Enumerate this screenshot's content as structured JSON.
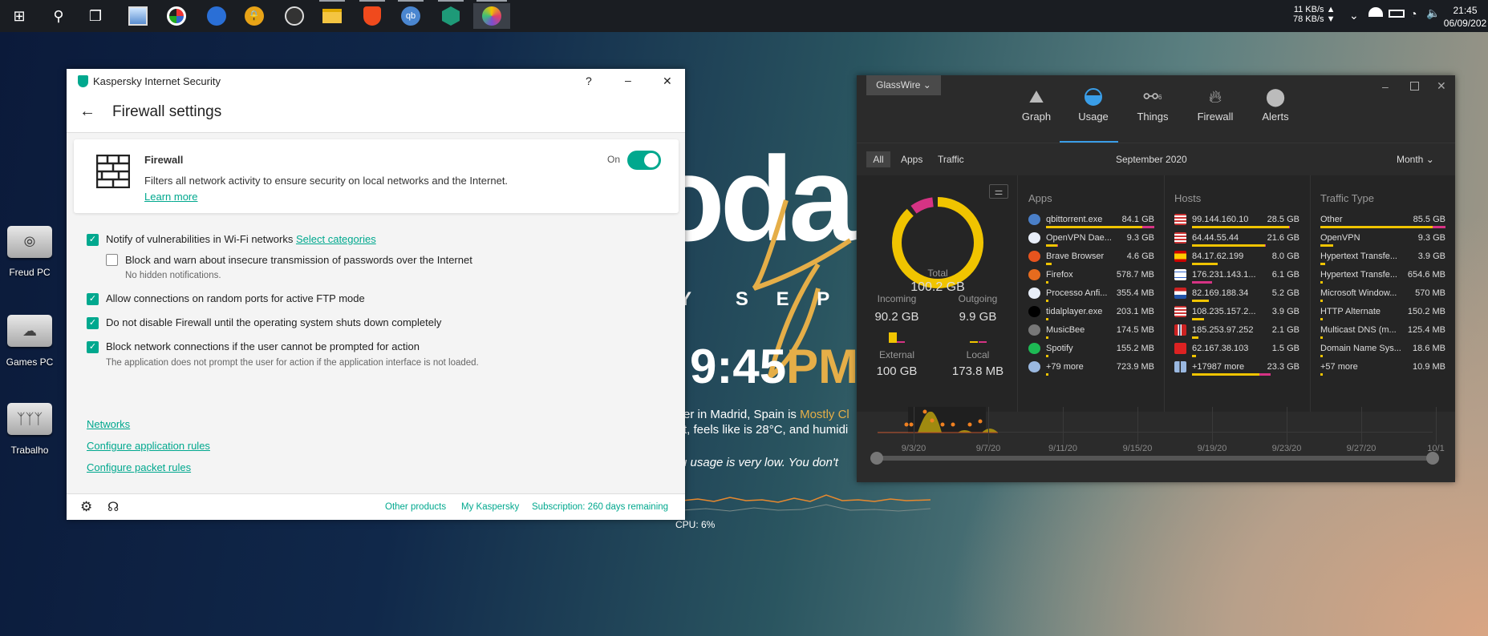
{
  "taskbar": {
    "apps": [
      "start",
      "search",
      "task-view",
      "monitor-app",
      "color-app",
      "nordvpn",
      "lock-app",
      "musicbee",
      "file-explorer",
      "brave",
      "qbittorrent",
      "green-app",
      "glasswire"
    ],
    "net_up": "11 KB/s ▲",
    "net_down": "78 KB/s ▼",
    "time": "21:45",
    "date": "06/09/202"
  },
  "desktop": {
    "icons": [
      {
        "label": "Freud PC"
      },
      {
        "label": "Games PC"
      },
      {
        "label": "Trabalho"
      }
    ]
  },
  "widget": {
    "big": "oda",
    "month": "Y  S E P T E",
    "time": "9:45",
    "ampm": "PM",
    "weather1a": "er in Madrid, Spain is ",
    "weather1b": "Mostly Cl",
    "weather2": "t, feels like is 28°C, and humidi",
    "cpu_msg": "u usage is very low. You don't",
    "cpu": "CPU: 6%"
  },
  "kaspersky": {
    "title": "Kaspersky Internet Security",
    "help": "?",
    "minimize": "–",
    "close": "✕",
    "page_title": "Firewall settings",
    "card": {
      "title": "Firewall",
      "desc": "Filters all network activity to ensure security on local networks and the Internet. ",
      "learn": "Learn",
      "more": "more",
      "toggle_label": "On",
      "toggle_on": true
    },
    "options": [
      {
        "label": "Notify of vulnerabilities in Wi-Fi networks ",
        "link": "Select categories",
        "checked": true
      },
      {
        "label": "Block and warn about insecure transmission of passwords over the Internet",
        "checked": false,
        "note": "No hidden notifications."
      },
      {
        "label": "Allow connections on random ports for active FTP mode",
        "checked": true
      },
      {
        "label": "Do not disable Firewall until the operating system shuts down completely",
        "checked": true
      },
      {
        "label": "Block network connections if the user cannot be prompted for action",
        "checked": true,
        "note": "The application does not prompt the user for action if the application interface is not loaded."
      }
    ],
    "links": [
      "Networks",
      "Configure application rules",
      "Configure packet rules"
    ],
    "footer": {
      "other": "Other products",
      "my": "My Kaspersky",
      "sub": "Subscription: 260 days remaining"
    }
  },
  "glasswire": {
    "menu": "GlassWire ⌄",
    "nav": [
      {
        "label": "Graph"
      },
      {
        "label": "Usage"
      },
      {
        "label": "Things",
        "badge": "6"
      },
      {
        "label": "Firewall"
      },
      {
        "label": "Alerts"
      }
    ],
    "active_nav": "Usage",
    "tabs": [
      "All",
      "Apps",
      "Traffic"
    ],
    "period": "September 2020",
    "range": "Month",
    "total_label": "Total",
    "total": "100.2 GB",
    "incoming_label": "Incoming",
    "incoming": "90.2 GB",
    "outgoing_label": "Outgoing",
    "outgoing": "9.9 GB",
    "external_label": "External",
    "external": "100 GB",
    "local_label": "Local",
    "local": "173.8 MB",
    "donut": {
      "incoming_fraction": 0.9,
      "outgoing_fraction": 0.1
    },
    "apps_header": "Apps",
    "hosts_header": "Hosts",
    "traffic_header": "Traffic Type",
    "apps": [
      {
        "name": "qbittorrent.exe",
        "value": "84.1 GB",
        "in": 0.89,
        "out": 0.11,
        "color": "#4a7fc8"
      },
      {
        "name": "OpenVPN Dae...",
        "value": "9.3 GB",
        "in": 0.1,
        "out": 0.01,
        "color": "#e8eef8"
      },
      {
        "name": "Brave Browser",
        "value": "4.6 GB",
        "in": 0.05,
        "out": 0,
        "color": "#e8541e"
      },
      {
        "name": "Firefox",
        "value": "578.7 MB",
        "in": 0.01,
        "out": 0,
        "color": "#e66b1e"
      },
      {
        "name": "Processo Anfi...",
        "value": "355.4 MB",
        "in": 0.01,
        "out": 0,
        "color": "#e8eef8"
      },
      {
        "name": "tidalplayer.exe",
        "value": "203.1 MB",
        "in": 0.01,
        "out": 0,
        "color": "#000000"
      },
      {
        "name": "MusicBee",
        "value": "174.5 MB",
        "in": 0.01,
        "out": 0,
        "color": "#777777"
      },
      {
        "name": "Spotify",
        "value": "155.2 MB",
        "in": 0.01,
        "out": 0,
        "color": "#1db954"
      },
      {
        "name": "+79 more",
        "value": "723.9 MB",
        "in": 0.01,
        "out": 0,
        "color": "#9ab8e0"
      }
    ],
    "hosts": [
      {
        "name": "99.144.160.10",
        "value": "28.5 GB",
        "in": 0.9,
        "out": 0.01,
        "flag": "us"
      },
      {
        "name": "64.44.55.44",
        "value": "21.6 GB",
        "in": 0.68,
        "out": 0.01,
        "flag": "us"
      },
      {
        "name": "84.17.62.199",
        "value": "8.0 GB",
        "in": 0.24,
        "out": 0,
        "flag": "es"
      },
      {
        "name": "176.231.143.1...",
        "value": "6.1 GB",
        "in": 0,
        "out": 0.19,
        "flag": "il"
      },
      {
        "name": "82.169.188.34",
        "value": "5.2 GB",
        "in": 0.16,
        "out": 0,
        "flag": "nl"
      },
      {
        "name": "108.235.157.2...",
        "value": "3.9 GB",
        "in": 0.11,
        "out": 0,
        "flag": "us"
      },
      {
        "name": "185.253.97.252",
        "value": "2.1 GB",
        "in": 0.06,
        "out": 0,
        "flag": "no"
      },
      {
        "name": "62.167.38.103",
        "value": "1.5 GB",
        "in": 0.04,
        "out": 0,
        "flag": "ch"
      },
      {
        "name": "+17987 more",
        "value": "23.3 GB",
        "in": 0.63,
        "out": 0.1,
        "flag": "grid"
      }
    ],
    "traffic": [
      {
        "name": "Other",
        "value": "85.5 GB",
        "in": 0.9,
        "out": 0.1
      },
      {
        "name": "OpenVPN",
        "value": "9.3 GB",
        "in": 0.1,
        "out": 0
      },
      {
        "name": "Hypertext Transfe...",
        "value": "3.9 GB",
        "in": 0.04,
        "out": 0
      },
      {
        "name": "Hypertext Transfe...",
        "value": "654.6 MB",
        "in": 0.01,
        "out": 0
      },
      {
        "name": "Microsoft Window...",
        "value": "570 MB",
        "in": 0.01,
        "out": 0
      },
      {
        "name": "HTTP Alternate",
        "value": "150.2 MB",
        "in": 0.01,
        "out": 0
      },
      {
        "name": "Multicast DNS (m...",
        "value": "125.4 MB",
        "in": 0.01,
        "out": 0
      },
      {
        "name": "Domain Name Sys...",
        "value": "18.6 MB",
        "in": 0.01,
        "out": 0
      },
      {
        "name": "+57 more",
        "value": "10.9 MB",
        "in": 0.01,
        "out": 0
      }
    ],
    "timeline": {
      "ticks": [
        "9/3/20",
        "9/7/20",
        "9/11/20",
        "9/15/20",
        "9/19/20",
        "9/23/20",
        "9/27/20",
        "10/1"
      ]
    },
    "colors": {
      "accent": "#3a9ee8",
      "incoming": "#f0c400",
      "outgoing": "#d63384"
    }
  }
}
